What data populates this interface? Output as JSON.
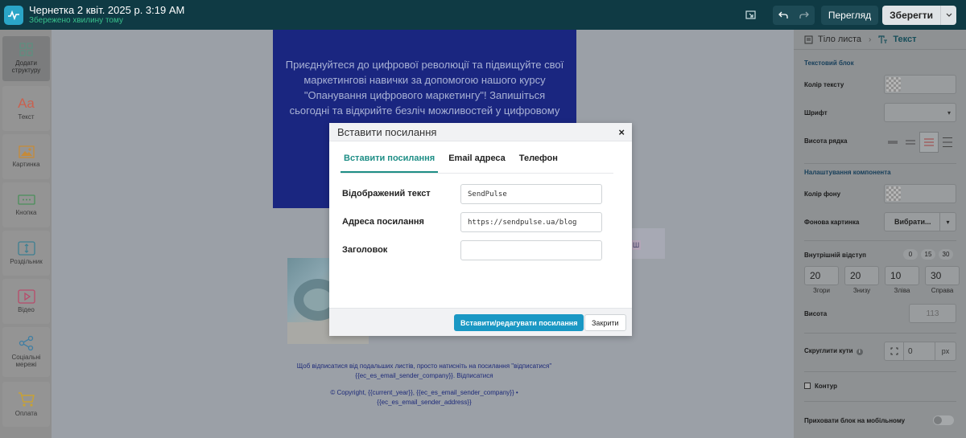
{
  "header": {
    "title": "Чернетка 2 квіт. 2025 р. 3:19 AM",
    "status": "Збережено хвилину тому",
    "preview_label": "Перегляд",
    "save_label": "Зберегти",
    "icons": [
      "app-logo-icon",
      "template-icon",
      "undo-icon",
      "redo-icon",
      "chevron-down-icon"
    ]
  },
  "sidebar": {
    "items": [
      {
        "label": "Додати структуру",
        "icon": "grid-icon",
        "color": "#5d8f80"
      },
      {
        "label": "Текст",
        "icon": "text-aa-icon",
        "color": "#c9614f"
      },
      {
        "label": "Картинка",
        "icon": "image-icon",
        "color": "#c58a39"
      },
      {
        "label": "Кнопка",
        "icon": "button-icon",
        "color": "#4b8f5a"
      },
      {
        "label": "Роздільник",
        "icon": "divider-icon",
        "color": "#3d7f91"
      },
      {
        "label": "Відео",
        "icon": "video-play-icon",
        "color": "#b84a6a"
      },
      {
        "label": "Соціальні мережі",
        "icon": "share-icon",
        "color": "#3f7ea3"
      },
      {
        "label": "Оплата",
        "icon": "cart-icon",
        "color": "#c9a233"
      }
    ]
  },
  "canvas": {
    "hero_text": "Приєднуйтеся до цифрової революції та підвищуйте свої маркетингові навички за допомогою нашого курсу \"Опанування цифрового маркетингу\"! Запишіться сьогодні та відкрийте безліч можливостей у цифровому",
    "chip_text": "Ш",
    "unsubscribe_text": "Щоб відписатися від подальших листів, просто натисніть на посилання \"відписатися\"",
    "unsubscribe_company": "{{ec_es_email_sender_company}}.",
    "unsubscribe_link": "Відписатися",
    "copyright_line1": "© Copyright, {{current_year}}, {{ec_es_email_sender_company}} •",
    "copyright_line2": "{{ec_es_email_sender_address}}"
  },
  "right_panel": {
    "tabs": [
      {
        "label": "Тіло листа",
        "icon": "body-icon"
      },
      {
        "label": "Текст",
        "icon": "text-icon"
      }
    ],
    "text_block_title": "Текстовий блок",
    "text_color_label": "Колір тексту",
    "font_label": "Шрифт",
    "line_height_label": "Висота рядка",
    "component_title": "Налаштування компонента",
    "bg_color_label": "Колір фону",
    "bg_image_label": "Фонова картинка",
    "choose_label": "Вибрати...",
    "padding_label": "Внутрішній відступ",
    "padding_presets": [
      "0",
      "15",
      "30"
    ],
    "padding": [
      {
        "value": "20",
        "caption": "Згори"
      },
      {
        "value": "20",
        "caption": "Знизу"
      },
      {
        "value": "10",
        "caption": "Зліва"
      },
      {
        "value": "30",
        "caption": "Справа"
      }
    ],
    "height_label": "Висота",
    "height_value": "113",
    "rounded_label": "Скруглити кути",
    "rounded_value": "0",
    "rounded_unit": "px",
    "border_label": "Контур",
    "hide_mobile_label": "Приховати блок на мобільному"
  },
  "modal": {
    "title": "Вставити посилання",
    "close_glyph": "×",
    "tabs": [
      "Вставити посилання",
      "Email адреса",
      "Телефон"
    ],
    "fields": [
      {
        "label": "Відображений текст",
        "value": "SendPulse"
      },
      {
        "label": "Адреса посилання",
        "value": "https://sendpulse.ua/blog"
      },
      {
        "label": "Заголовок",
        "value": ""
      }
    ],
    "primary_label": "Вставити/редагувати посилання",
    "close_label": "Закрити",
    "accent": "#1e8e86",
    "button_color": "#1a98c4"
  }
}
